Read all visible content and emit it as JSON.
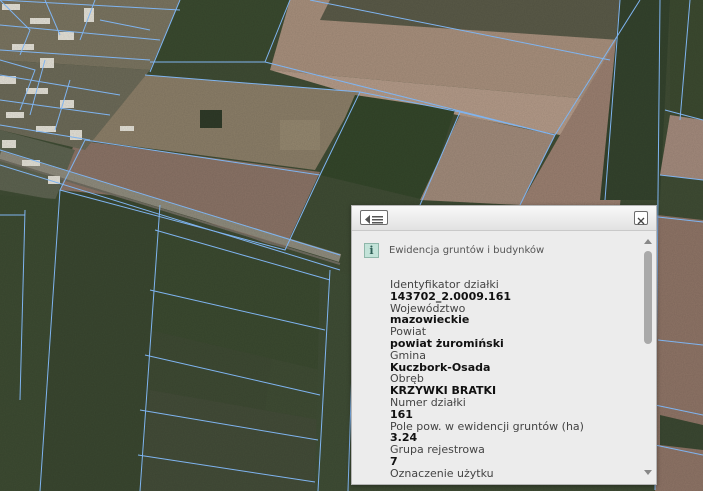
{
  "map": {
    "parcel_line_color": "#7fb4f0",
    "building_color": "#e6e6e6"
  },
  "popup": {
    "list_icon": "list-toggle-icon",
    "close_icon": "close-icon",
    "info_icon_glyph": "i",
    "info_title": "Ewidencja gruntów i budynków",
    "fields": [
      {
        "label": "Identyfikator działki",
        "value": "143702_2.0009.161"
      },
      {
        "label": "Województwo",
        "value": "mazowieckie"
      },
      {
        "label": "Powiat",
        "value": "powiat żuromiński"
      },
      {
        "label": "Gmina",
        "value": "Kuczbork-Osada"
      },
      {
        "label": "Obręb",
        "value": "KRZYWKI BRATKI"
      },
      {
        "label": "Numer działki",
        "value": "161"
      },
      {
        "label": "Pole pow. w ewidencji gruntów (ha)",
        "value": "3.24"
      },
      {
        "label": "Grupa rejestrowa",
        "value": "7"
      },
      {
        "label": "Oznaczenie użytku",
        "value": ""
      }
    ]
  }
}
